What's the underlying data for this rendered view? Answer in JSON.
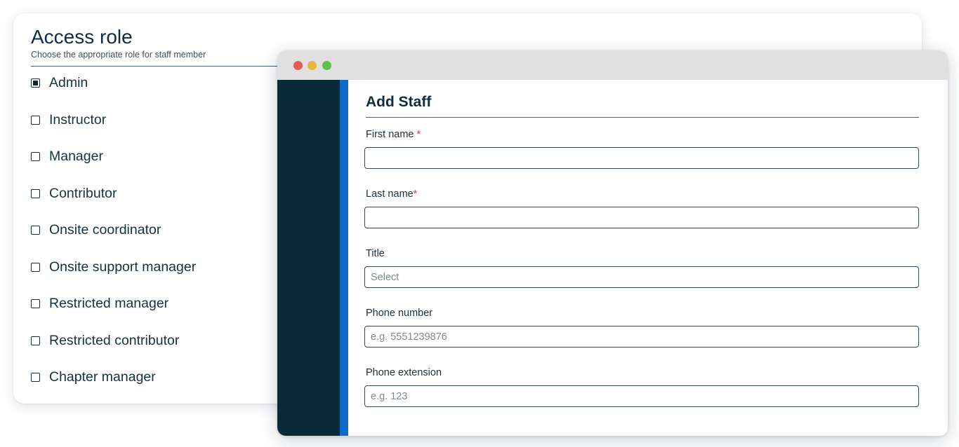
{
  "access_role": {
    "title": "Access role",
    "subtitle": "Choose the appropriate role for staff member",
    "roles": [
      {
        "label": "Admin",
        "checked": true
      },
      {
        "label": "Instructor",
        "checked": false
      },
      {
        "label": "Manager",
        "checked": false
      },
      {
        "label": "Contributor",
        "checked": false
      },
      {
        "label": "Onsite coordinator",
        "checked": false
      },
      {
        "label": "Onsite support manager",
        "checked": false
      },
      {
        "label": "Restricted manager",
        "checked": false
      },
      {
        "label": "Restricted contributor",
        "checked": false
      },
      {
        "label": "Chapter manager",
        "checked": false
      }
    ]
  },
  "window": {
    "traffic_lights": [
      "close-icon",
      "minimize-icon",
      "maximize-icon"
    ]
  },
  "form": {
    "title": "Add Staff",
    "required_marker": "*",
    "first_name": {
      "label": "First name",
      "value": ""
    },
    "last_name": {
      "label": "Last name",
      "value": ""
    },
    "title_field": {
      "label": "Title",
      "selected": "Select"
    },
    "phone_number": {
      "label": "Phone number",
      "placeholder": "e.g. 5551239876",
      "value": ""
    },
    "phone_extension": {
      "label": "Phone extension",
      "placeholder": "e.g. 123",
      "value": ""
    }
  },
  "colors": {
    "sidebar": "#0a2a38",
    "sidebar_accent": "#1068c7",
    "required": "#d94040",
    "heading": "#0d2e40"
  }
}
